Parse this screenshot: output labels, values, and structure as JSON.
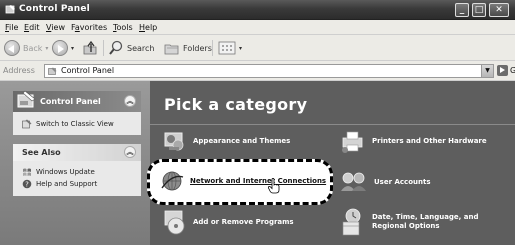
{
  "window": {
    "title": "Control Panel"
  },
  "menu": {
    "items": [
      {
        "key": "F",
        "rest": "ile"
      },
      {
        "key": "E",
        "rest": "dit"
      },
      {
        "key": "V",
        "rest": "iew"
      },
      {
        "pre": "F",
        "key": "a",
        "rest": "vorites"
      },
      {
        "key": "T",
        "rest": "ools"
      },
      {
        "key": "H",
        "rest": "elp"
      }
    ]
  },
  "toolbar": {
    "back_label": "Back",
    "search_label": "Search",
    "folders_label": "Folders"
  },
  "address": {
    "label": "Address",
    "value": "Control Panel",
    "go_label": "Go"
  },
  "left": {
    "control_panel": {
      "title": "Control Panel",
      "task": "Switch to Classic View"
    },
    "see_also": {
      "title": "See Also",
      "links": [
        "Windows Update",
        "Help and Support"
      ]
    }
  },
  "main": {
    "heading": "Pick a category",
    "categories": [
      {
        "label": "Appearance and Themes",
        "icon": "appearance-icon"
      },
      {
        "label": "Printers and Other Hardware",
        "icon": "printer-icon"
      },
      {
        "label": "Network and Internet Connections",
        "icon": "network-icon"
      },
      {
        "label": "User Accounts",
        "icon": "users-icon"
      },
      {
        "label": "Add or Remove Programs",
        "icon": "cd-icon"
      },
      {
        "label": "Date, Time, Language, and Regional Options",
        "icon": "datetime-icon"
      }
    ]
  }
}
